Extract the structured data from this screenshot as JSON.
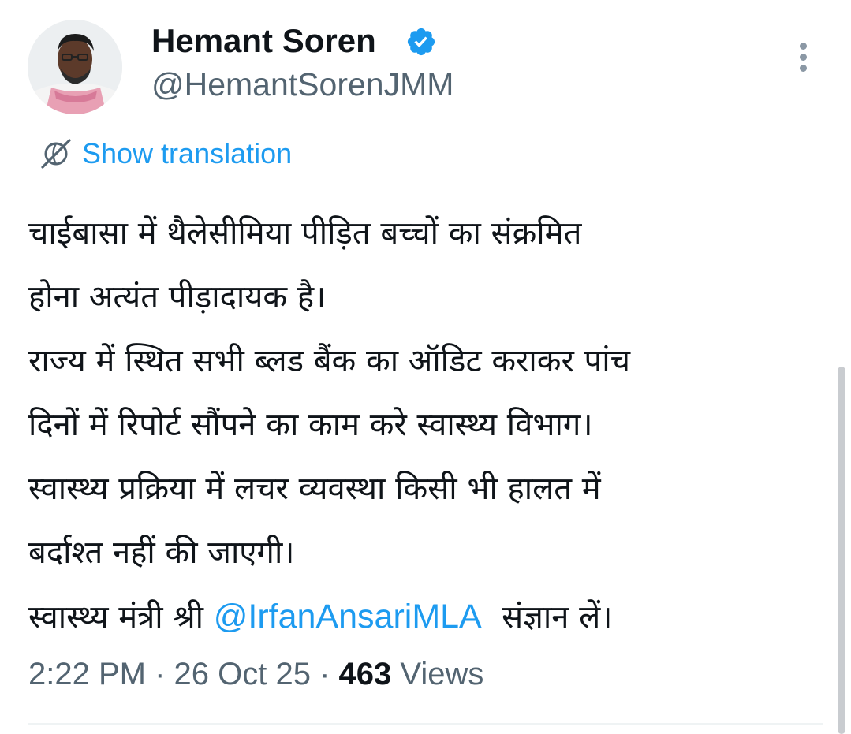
{
  "author": {
    "display_name": "Hemant Soren",
    "handle": "@HemantSorenJMM",
    "verified": true,
    "avatar_icon": "profile-photo"
  },
  "menu": {
    "icon": "more-vertical-icon"
  },
  "translation": {
    "icon": "globe-slash-icon",
    "label": "Show translation"
  },
  "tweet": {
    "line1": "चाईबासा में थैलेसीमिया पीड़ित बच्चों का संक्रमित",
    "line2": "होना अत्यंत पीड़ादायक है।",
    "line3": "राज्य में स्थित सभी ब्लड बैंक का ऑडिट कराकर पांच",
    "line4": "दिनों में रिपोर्ट सौंपने का काम करे स्वास्थ्य विभाग।",
    "line5": "स्वास्थ्य प्रक्रिया में लचर व्यवस्था किसी भी हालत में",
    "line6": "बर्दाश्त नहीं की जाएगी।",
    "line7_prefix": "स्वास्थ्य मंत्री श्री ",
    "mention": "@IrfanAnsariMLA",
    "line7_suffix": "  संज्ञान लें।"
  },
  "meta": {
    "time": "2:22 PM",
    "separator": " · ",
    "date": "26 Oct 25",
    "views_count": "463",
    "views_label": " Views"
  },
  "colors": {
    "accent": "#1d9bf0",
    "text": "#0f1419",
    "secondary": "#536471"
  }
}
